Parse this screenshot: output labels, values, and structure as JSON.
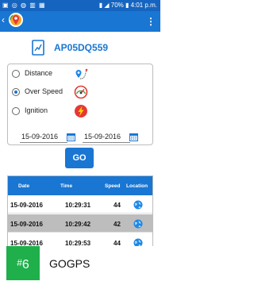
{
  "status_bar": {
    "left_icons": "▣ ◎ ◍ ▥ ▦",
    "right_text": "▮ ◢ 70% ▮ 4:01 p.m."
  },
  "app_bar": {
    "back_icon": "chevron-left-icon",
    "logo_icon": "gps-pin-logo",
    "menu_icon": "more-vertical-icon"
  },
  "vehicle": {
    "number": "AP05DQ559"
  },
  "options": [
    {
      "label": "Distance",
      "checked": false,
      "icon": "route-pin-icon"
    },
    {
      "label": "Over Speed",
      "checked": true,
      "icon": "speedometer-icon"
    },
    {
      "label": "Ignition",
      "checked": false,
      "icon": "ignition-icon"
    }
  ],
  "dates": {
    "from": "15-09-2016",
    "to": "15-09-2016"
  },
  "go_label": "GO",
  "table": {
    "headers": [
      "Date",
      "Time",
      "Speed",
      "Location"
    ],
    "rows": [
      {
        "date": "15-09-2016",
        "time": "10:29:31",
        "speed": "44"
      },
      {
        "date": "15-09-2016",
        "time": "10:29:42",
        "speed": "42"
      },
      {
        "date": "15-09-2016",
        "time": "10:29:53",
        "speed": "44"
      }
    ]
  },
  "banner": {
    "rank": "6",
    "app_name": "GOGPS"
  },
  "colors": {
    "primary": "#1976d2",
    "status": "#1565c0",
    "badge": "#1faf4b"
  }
}
